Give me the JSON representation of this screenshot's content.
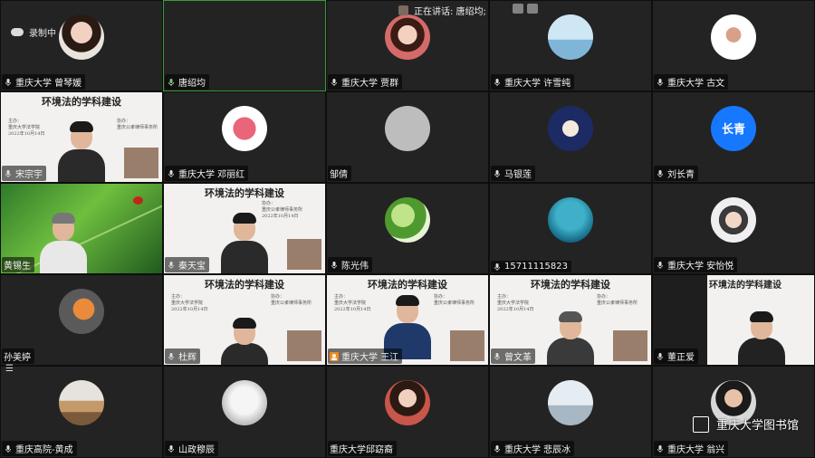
{
  "top": {
    "recording_label": "录制中",
    "speaking_label": "正在讲话: 唐绍均;"
  },
  "slide": {
    "title": "环境法的学科建设",
    "host_label": "主办：",
    "host": "重庆大学法学院",
    "co_label": "协办：",
    "co": "重庆公孝律师事务所",
    "date": "2022年10月14日"
  },
  "tiles": [
    {
      "name": "重庆大学 曾琴媛",
      "mic": "on"
    },
    {
      "name": "唐绍均",
      "mic": "on"
    },
    {
      "name": "重庆大学 贾群",
      "mic": "on"
    },
    {
      "name": "重庆大学 许雪纯",
      "mic": "on"
    },
    {
      "name": "重庆大学 古文",
      "mic": "on"
    },
    {
      "name": "宋宗宇",
      "mic": "on"
    },
    {
      "name": "重庆大学 邓丽红",
      "mic": "on"
    },
    {
      "name": "邹倩",
      "mic": "none"
    },
    {
      "name": "马银莲",
      "mic": "on"
    },
    {
      "name": "刘长青",
      "mic": "on",
      "avatar_text": "长青"
    },
    {
      "name": "黄锡生",
      "mic": "none"
    },
    {
      "name": "秦天宝",
      "mic": "on"
    },
    {
      "name": "陈光伟",
      "mic": "on"
    },
    {
      "name": "15711115823",
      "mic": "on"
    },
    {
      "name": "重庆大学 安怡悦",
      "mic": "on"
    },
    {
      "name": "孙美婷",
      "mic": "none"
    },
    {
      "name": "杜辉",
      "mic": "on"
    },
    {
      "name": "重庆大学 王江",
      "mic": "on"
    },
    {
      "name": "曾文革",
      "mic": "on"
    },
    {
      "name": "董正爱",
      "mic": "on"
    },
    {
      "name": "重庆高院-黄成",
      "mic": "on"
    },
    {
      "name": "山政穆辰",
      "mic": "on"
    },
    {
      "name": "重庆大学邱窈裔",
      "mic": "none"
    },
    {
      "name": "重庆大学 悲辰冰",
      "mic": "on"
    },
    {
      "name": "重庆大学 翁兴",
      "mic": "on"
    }
  ],
  "watermark": "重庆大学图书馆",
  "colors": {
    "active_speaker_border": "#3a9a3a",
    "avatar_blue": "#1677ff"
  }
}
